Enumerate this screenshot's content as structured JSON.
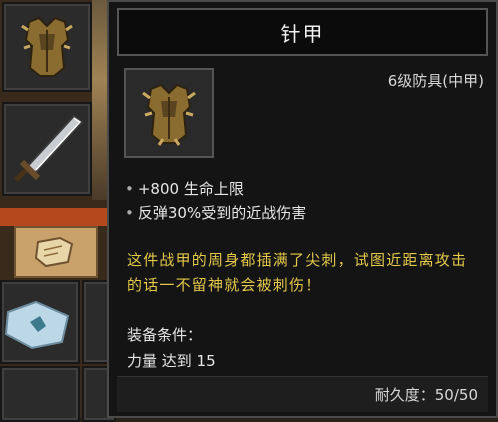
{
  "tooltip": {
    "title": "针甲",
    "category": "6级防具(中甲)",
    "stats": [
      "+800 生命上限",
      "反弹30%受到的近战伤害"
    ],
    "flavor": "这件战甲的周身都插满了尖刺，试图近距离攻击的话一不留神就会被刺伤！",
    "requirement_label": "装备条件：",
    "requirement_value": "力量 达到 15",
    "durability": "耐久度：50/50"
  },
  "icons": {
    "armor": "spiked-armor-icon",
    "sword": "sword-icon",
    "scroll": "scroll-icon",
    "map": "map-icon"
  },
  "colors": {
    "flavor_text": "#e3c84a",
    "tooltip_bg": "#141414"
  }
}
